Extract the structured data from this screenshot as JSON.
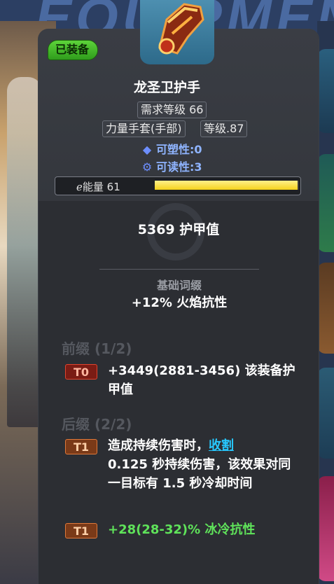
{
  "background": {
    "title": "EQUIPMENT"
  },
  "tooltip": {
    "equipped_badge": "已装备",
    "item_icon": "gauntlet-icon",
    "item_name": "龙圣卫护手",
    "tags": {
      "required_level": "需求等级 66",
      "item_type": "力量手套(手部)",
      "item_level": "等级.87"
    },
    "plasticity": "可塑性:0",
    "readability": "可读性:3",
    "energy": {
      "label": "能量 61",
      "fill_fraction": 0.99
    },
    "armor_value": "5369 护甲值",
    "base_affix": {
      "title": "基础词缀",
      "text": "+12% 火焰抗性"
    },
    "prefix": {
      "title": "前缀 (1/2)",
      "affixes": [
        {
          "tier": "T0",
          "text": "+3449(2881-3456) 该装备护甲值"
        }
      ]
    },
    "suffix": {
      "title": "后缀 (2/2)",
      "affixes": [
        {
          "tier": "T1",
          "text_before": "造成持续伤害时，",
          "keyword": "收割",
          "text_after": "0.125 秒持续伤害，该效果对同一目标有 1.5 秒冷却时间"
        },
        {
          "tier": "T1",
          "text": "+28(28-32)% 冰冷抗性"
        }
      ]
    }
  },
  "colors": {
    "panel": "#2c2e33",
    "equipped_green": "#3fb52a",
    "keyword_cyan": "#27c8ff",
    "cold_res_green": "#5fe35a",
    "energy_yellow": "#f4d21c"
  }
}
